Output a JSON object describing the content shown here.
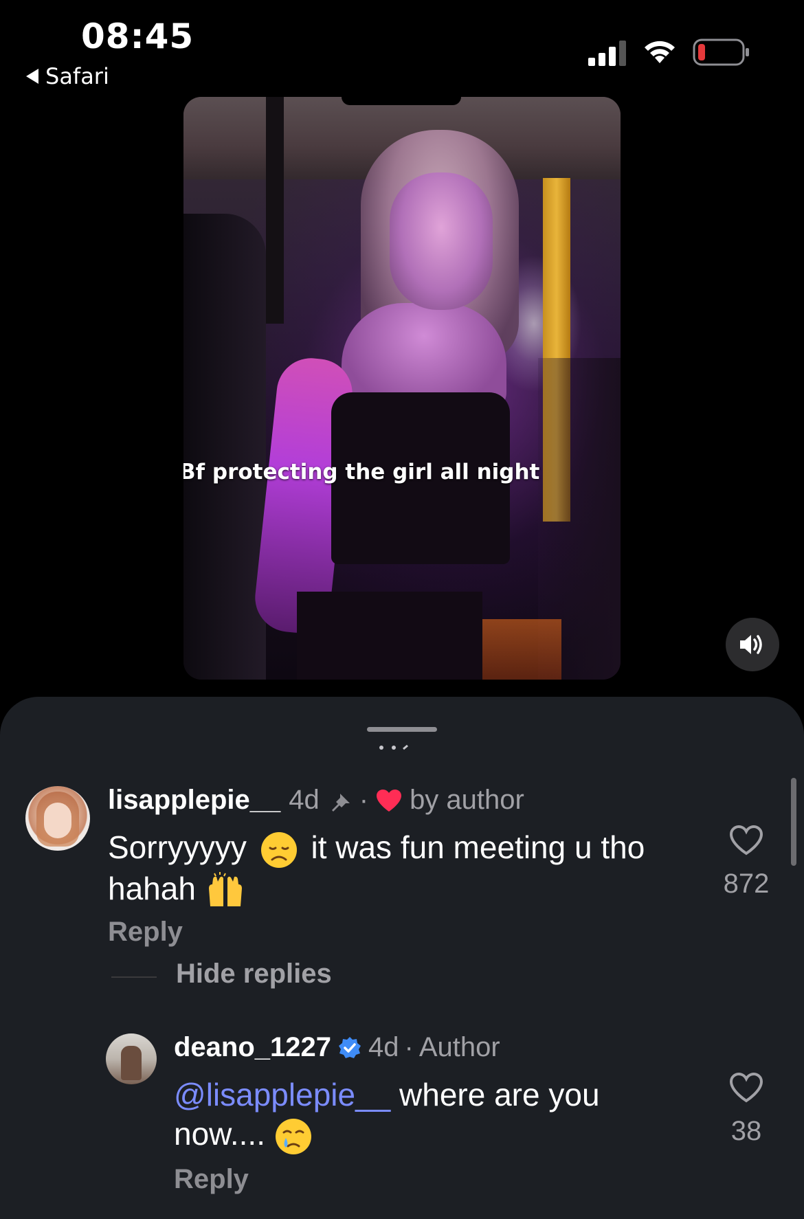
{
  "status_bar": {
    "time": "08:45",
    "back_app": "Safari",
    "battery_color": "#e5393b"
  },
  "video": {
    "caption": "Bf protecting the girl all night"
  },
  "comments": [
    {
      "username": "lisapplepie__",
      "age": "4d",
      "pinned": true,
      "liked_by_author": "by author",
      "text_part1": "Sorryyyyy",
      "emoji1": "disappointed-face",
      "text_part2": "it was fun meeting u tho",
      "text_line2": "hahah",
      "emoji2": "raising-hands",
      "likes": "872",
      "reply_label": "Reply",
      "hide_replies_label": "Hide replies"
    },
    {
      "username": "deano_1227",
      "verified": true,
      "age": "4d",
      "role": "Author",
      "mention": "@lisapplepie__",
      "text_part1": "where are you",
      "text_line2": "now....",
      "emoji1": "crying-face",
      "likes": "38",
      "reply_label": "Reply"
    }
  ],
  "colors": {
    "sheet_bg": "#1c1f24",
    "mention": "#7b8cff",
    "heart": "#ff2d55",
    "verified": "#3f8cf7"
  }
}
